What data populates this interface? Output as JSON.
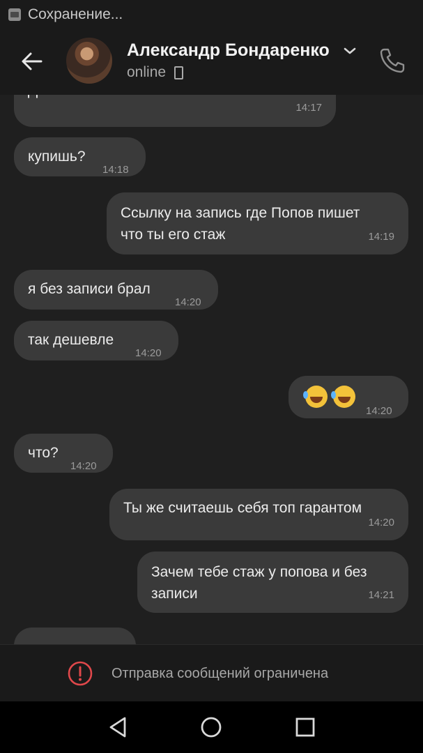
{
  "status_bar": {
    "text": "Сохранение..."
  },
  "header": {
    "name": "Александр Бондаренко",
    "status": "online"
  },
  "messages": [
    {
      "dir": "in",
      "text": "Да",
      "time": "14:17"
    },
    {
      "dir": "in",
      "text": "купишь?",
      "time": "14:18"
    },
    {
      "dir": "out",
      "text": "Ссылку на запись где Попов пишет\nчто ты его стаж",
      "time": "14:19"
    },
    {
      "dir": "in",
      "text": "я без записи брал",
      "time": "14:20"
    },
    {
      "dir": "in",
      "text": "так дешевле",
      "time": "14:20"
    },
    {
      "dir": "out",
      "text": "",
      "emoji": [
        "rofl-emoji",
        "rofl-emoji"
      ],
      "time": "14:20"
    },
    {
      "dir": "in",
      "text": "что?",
      "time": "14:20"
    },
    {
      "dir": "out",
      "text": "Ты же считаешь себя топ гарантом",
      "time": "14:20"
    },
    {
      "dir": "out",
      "text": "Зачем тебе стаж у попова и без\nзаписи",
      "time": "14:21"
    }
  ],
  "restriction": {
    "text": "Отправка сообщений ограничена"
  },
  "navbar": {
    "icons": [
      "back-triangle-icon",
      "home-circle-icon",
      "recents-square-icon"
    ]
  }
}
